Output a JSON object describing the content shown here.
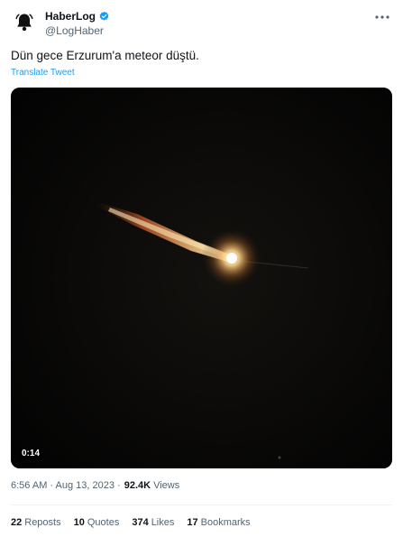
{
  "account": {
    "display_name": "HaberLog",
    "handle": "@LogHaber",
    "verified": true,
    "avatar_icon": "bell-icon"
  },
  "tweet": {
    "text": "Dün gece Erzurum'a meteor düştü.",
    "translate_label": "Translate Tweet"
  },
  "media": {
    "duration": "0:14"
  },
  "meta": {
    "timestamp": "6:56 AM · Aug 13, 2023 ·",
    "views_count": "92.4K",
    "views_label": "Views"
  },
  "stats": [
    {
      "count": "22",
      "label": "Reposts"
    },
    {
      "count": "10",
      "label": "Quotes"
    },
    {
      "count": "374",
      "label": "Likes"
    },
    {
      "count": "17",
      "label": "Bookmarks"
    }
  ],
  "colors": {
    "accent": "#1d9bf0",
    "secondary_text": "#536471"
  }
}
